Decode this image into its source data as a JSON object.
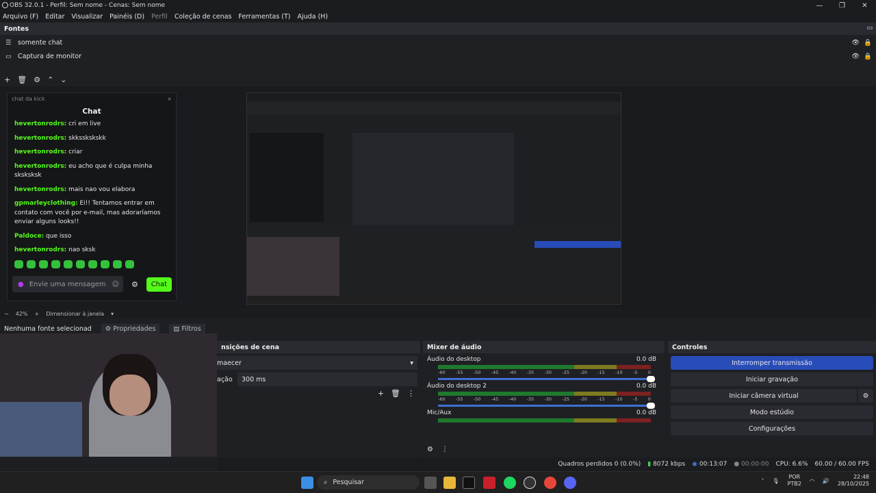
{
  "window": {
    "title": "OBS 32.0.1 - Perfil: Sem nome - Cenas: Sem nome"
  },
  "menu": [
    {
      "label": "Arquivo (F)"
    },
    {
      "label": "Editar"
    },
    {
      "label": "Visualizar"
    },
    {
      "label": "Painéis (D)"
    },
    {
      "label": "Perfil"
    },
    {
      "label": "Coleção de cenas"
    },
    {
      "label": "Ferramentas (T)"
    },
    {
      "label": "Ajuda (H)"
    }
  ],
  "sources": {
    "title": "Fontes",
    "items": [
      {
        "name": "somente chat"
      },
      {
        "name": "Captura de monitor"
      }
    ]
  },
  "chat": {
    "header": "chat da kick",
    "title": "Chat",
    "messages": [
      {
        "user": "hevertonrodrs:",
        "text": " cri em live"
      },
      {
        "user": "hevertonrodrs:",
        "text": " skksskskskk"
      },
      {
        "user": "hevertonrodrs:",
        "text": " criar"
      },
      {
        "user": "hevertonrodrs:",
        "text": " eu acho que é culpa minha sksksksk"
      },
      {
        "user": "hevertonrodrs:",
        "text": " mais nao vou elabora"
      },
      {
        "user": "gpmarleyclothing:",
        "text": " Ei!! Tentamos entrar em contato com você por e-mail, mas adoraríamos enviar alguns looks!!"
      },
      {
        "user": "Paldoce:",
        "text": " que isso"
      },
      {
        "user": "hevertonrodrs:",
        "text": " nao sksk"
      }
    ],
    "input_placeholder": "Envie uma mensagem",
    "send_label": "Chat"
  },
  "preview_status": {
    "zoom": "42%",
    "mode": "Dimensionar à janela"
  },
  "selection": {
    "none_label": "Nenhuma fonte selecionad",
    "properties": "Propriedades",
    "filters": "Filtros"
  },
  "transitions": {
    "title": "nsições de cena",
    "transition": "maecer",
    "duration_label": "ação",
    "duration": "300 ms"
  },
  "mixer": {
    "title": "Mixer de áudio",
    "channels": [
      {
        "name": "Áudio do desktop",
        "db": "0.0 dB"
      },
      {
        "name": "Áudio do desktop 2",
        "db": "0.0 dB"
      },
      {
        "name": "Mic/Aux",
        "db": "0.0 dB"
      }
    ],
    "scale": [
      "-60",
      "-55",
      "-50",
      "-45",
      "-40",
      "-35",
      "-30",
      "-25",
      "-20",
      "-15",
      "-10",
      "-5",
      "0"
    ]
  },
  "controls": {
    "title": "Controles",
    "stop_stream": "Interromper transmissão",
    "start_record": "Iniciar gravação",
    "virtual_cam": "Iniciar câmera virtual",
    "studio_mode": "Modo estúdio",
    "settings": "Configurações"
  },
  "status": {
    "dropped": "Quadros perdidos 0 (0.0%)",
    "bitrate": "8072 kbps",
    "stream_time": "00:13:07",
    "record_time": "00:00:00",
    "cpu": "CPU: 6.6%",
    "fps": "60.00 / 60.00 FPS"
  },
  "taskbar": {
    "search": "Pesquisar",
    "lang": "POR",
    "layout": "PTB2",
    "time": "22:48",
    "date": "28/10/2025"
  }
}
